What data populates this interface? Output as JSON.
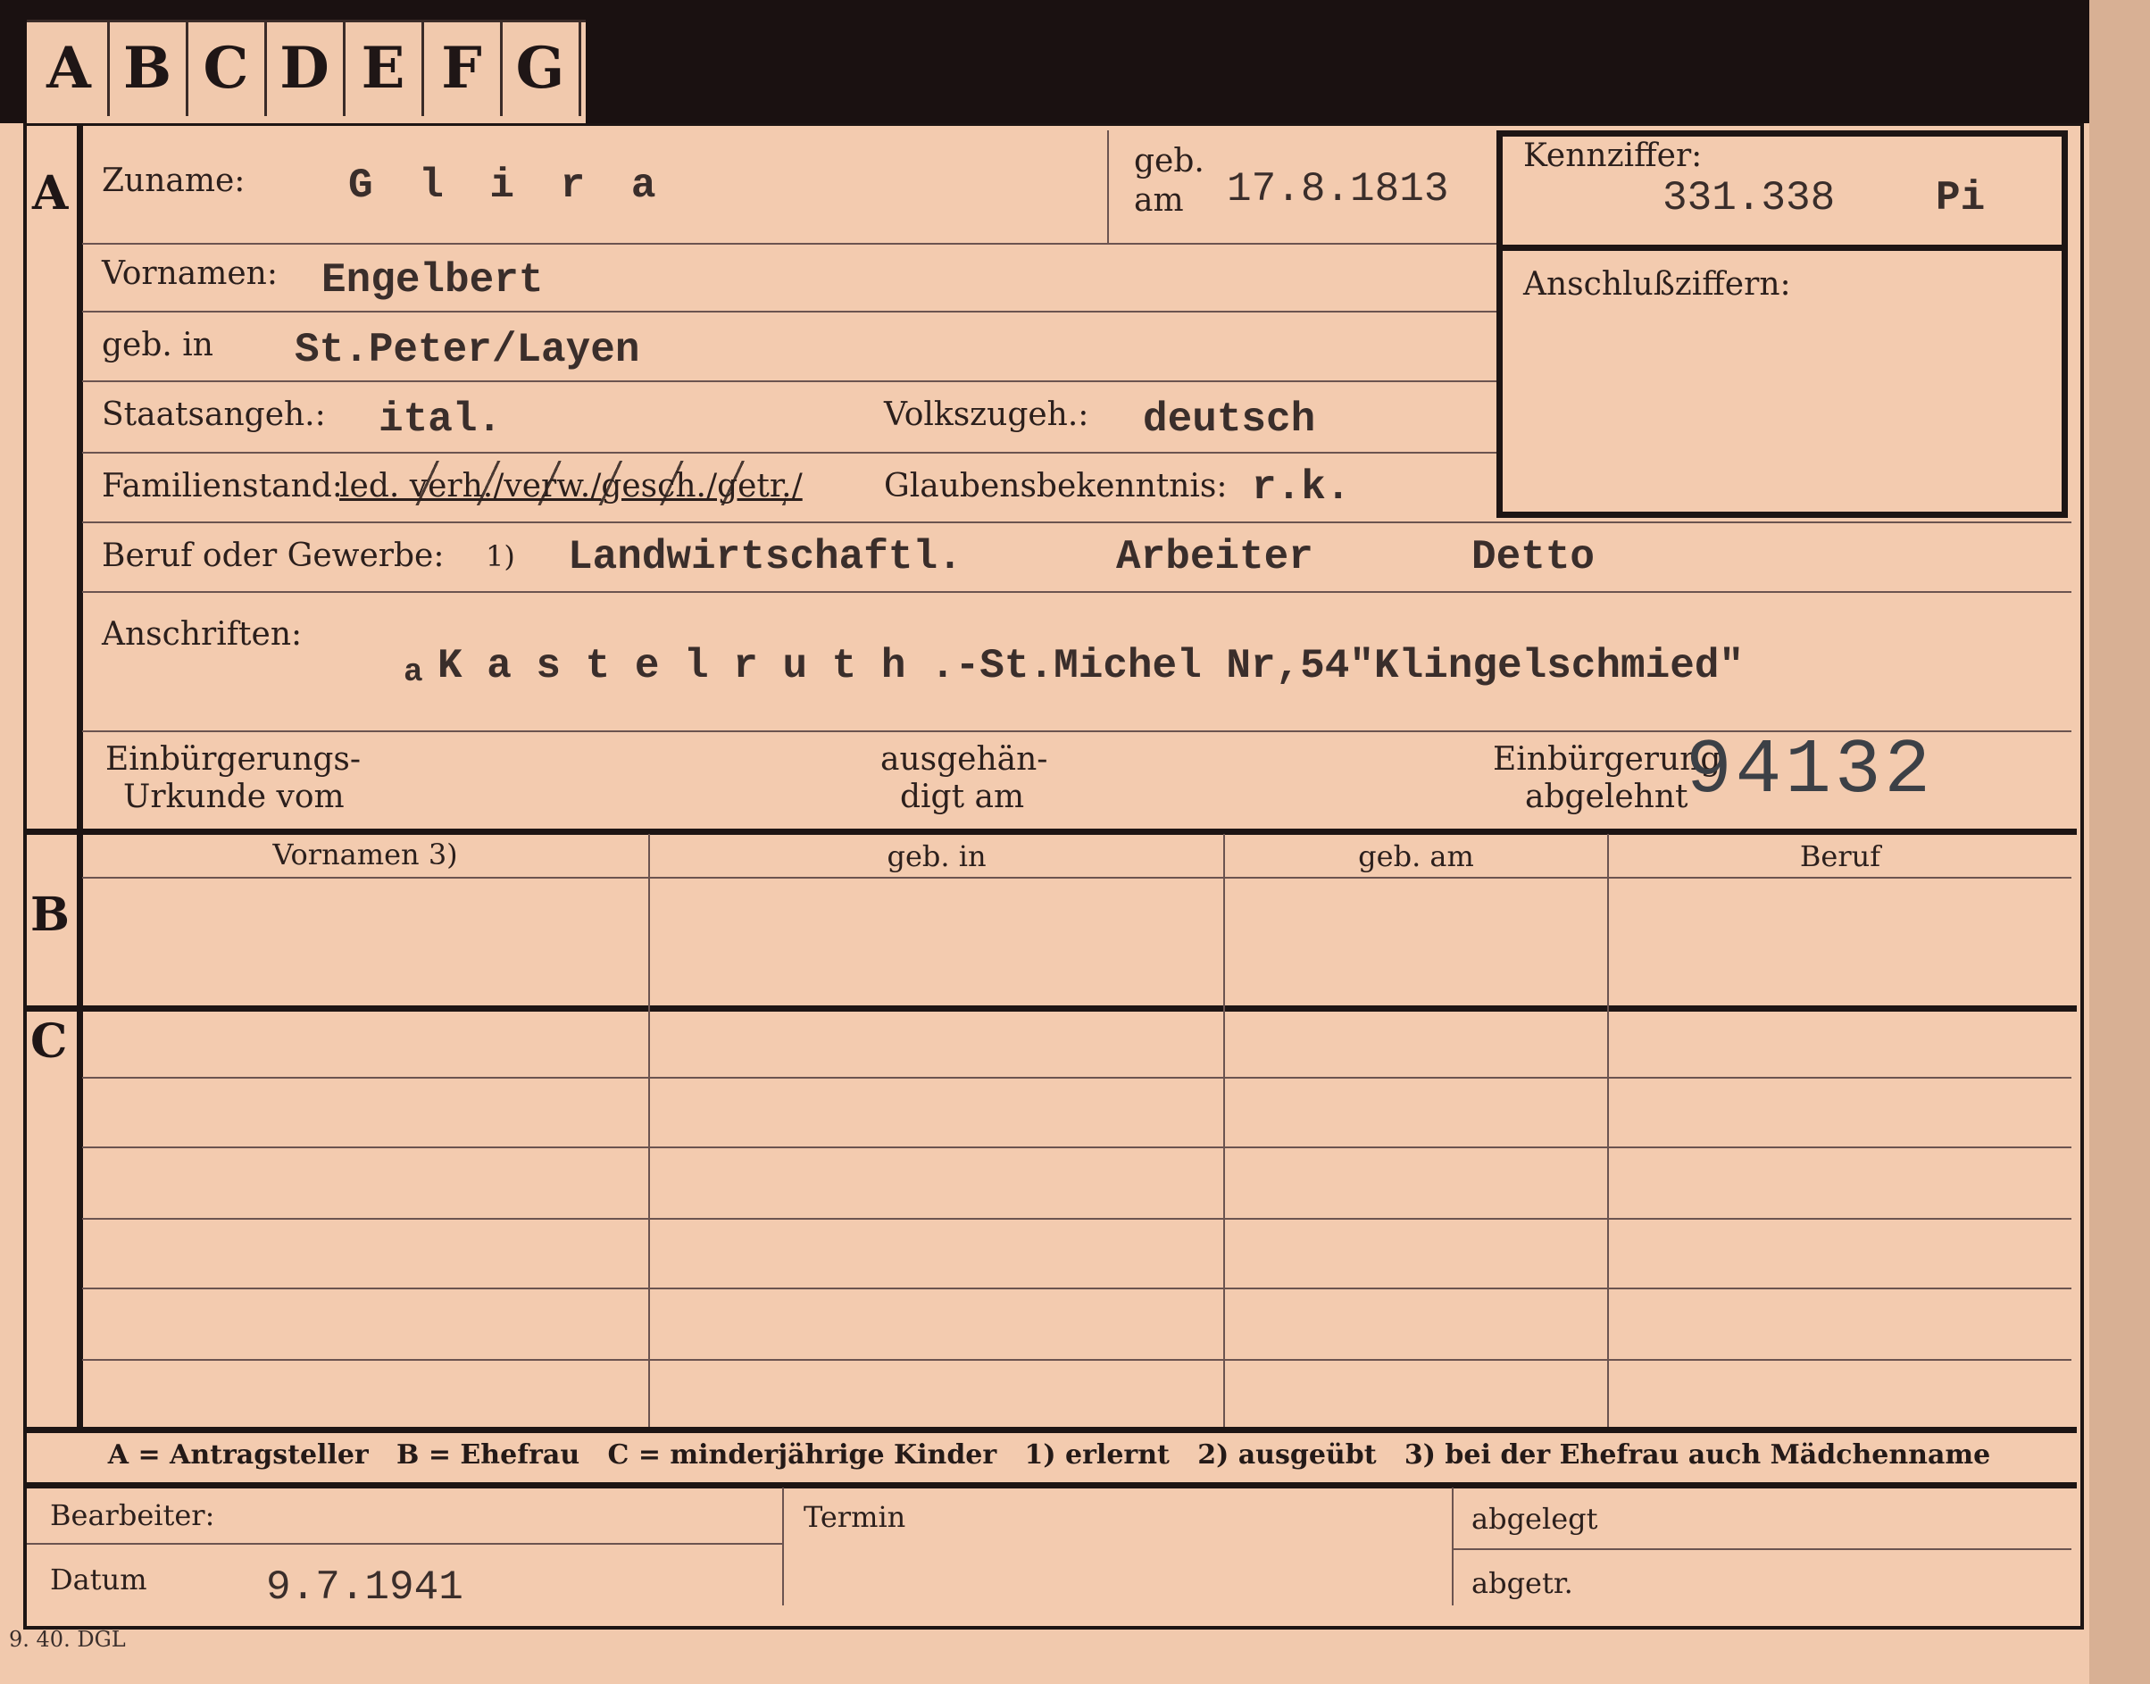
{
  "tabs": [
    "A",
    "B",
    "C",
    "D",
    "E",
    "F",
    "G"
  ],
  "section_letters": {
    "a": "A",
    "b": "B",
    "c": "C"
  },
  "header": {
    "zuname_label": "Zuname:",
    "zuname_value": "G l i r a",
    "geb_label_1": "geb.",
    "geb_label_2": "am",
    "geb_am_value": "17.8.1813",
    "kennziffer_label": "Kennziffer:",
    "kennziffer_value": "331.338",
    "kennziffer_suffix": "Pi",
    "anschluss_label": "Anschlußziffern:"
  },
  "person": {
    "vornamen_label": "Vornamen:",
    "vornamen_value": "Engelbert",
    "geb_in_label": "geb. in",
    "geb_in_value": "St.Peter/Layen",
    "staatsangeh_label": "Staatsangeh.:",
    "staatsangeh_value": "ital.",
    "volkszugeh_label": "Volkszugeh.:",
    "volkszugeh_value": "deutsch",
    "familienstand_label": "Familienstand:",
    "familienstand_options": "led. verh./verw./gesch./getr./",
    "glaubens_label": "Glaubensbekenntnis:",
    "glaubens_value": "r.k.",
    "beruf_label": "Beruf oder Gewerbe:",
    "beruf_note": "1)",
    "beruf_value_1": "Landwirtschaftl.",
    "beruf_value_2": "Arbeiter",
    "beruf_value_3": "Detto",
    "anschriften_label": "Anschriften:",
    "anschriften_prefix": "a",
    "anschriften_value": "K a s t e l r u  t h .-St.Michel Nr,54\"Klingelschmied\"",
    "einbuerg_urkunde_label_1": "Einbürgerungs-",
    "einbuerg_urkunde_label_2": "Urkunde vom",
    "ausgehaendigt_label_1": "ausgehän-",
    "ausgehaendigt_label_2": "digt am",
    "einbuerg_abgelehnt_label_1": "Einbürgerung",
    "einbuerg_abgelehnt_label_2": "abgelehnt",
    "stamp_number": "94132"
  },
  "table": {
    "columns": [
      "Vornamen 3)",
      "geb. in",
      "geb. am",
      "Beruf"
    ]
  },
  "legend": "A = Antragsteller   B = Ehefrau   C = minderjährige Kinder   1) erlernt   2) ausgeübt   3) bei der Ehefrau auch Mädchenname",
  "footer": {
    "bearbeiter_label": "Bearbeiter:",
    "datum_label": "Datum",
    "datum_value": "9.7.1941",
    "termin_label": "Termin",
    "abgelegt_label": "abgelegt",
    "abgetr_label": "abgetr.",
    "print_code": "9. 40. DGL"
  },
  "colors": {
    "card": "#f1c9ad",
    "border": "#1d1514",
    "tab_strip": "#1a1111"
  }
}
